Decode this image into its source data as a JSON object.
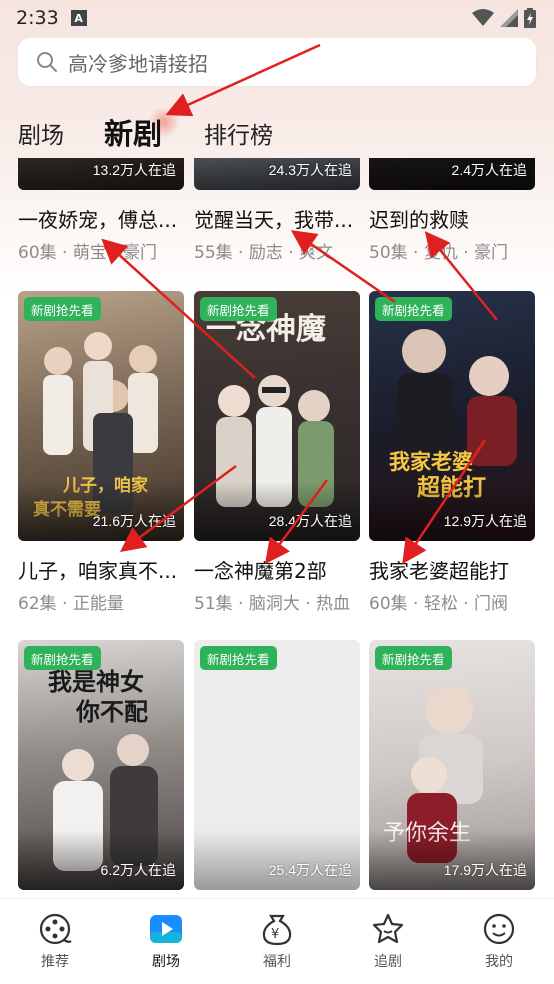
{
  "status_bar": {
    "time": "2:33",
    "notif_letter": "A"
  },
  "search": {
    "placeholder": "高冷爹地请接招"
  },
  "tabs": [
    {
      "label": "剧场",
      "active": false
    },
    {
      "label": "新剧",
      "active": true
    },
    {
      "label": "排行榜",
      "active": false
    }
  ],
  "top_row": [
    {
      "viewers": "13.2万人在追",
      "title": "一夜娇宠，傅总...",
      "meta": "60集 · 萌宝 · 豪门"
    },
    {
      "viewers": "24.3万人在追",
      "title": "觉醒当天，我带...",
      "meta": "55集 · 励志 · 爽文"
    },
    {
      "viewers": "2.4万人在追",
      "title": "迟到的救赎",
      "meta": "50集 · 复仇 · 豪门"
    }
  ],
  "middle_row": [
    {
      "badge": "新剧抢先看",
      "viewers": "21.6万人在追",
      "title": "儿子，咱家真不...",
      "meta": "62集 · 正能量",
      "poster_text": "儿子，咱家真不需要..."
    },
    {
      "badge": "新剧抢先看",
      "viewers": "28.4万人在追",
      "title": "一念神魔第2部",
      "meta": "51集 · 脑洞大 · 热血",
      "poster_text": "一念神魔"
    },
    {
      "badge": "新剧抢先看",
      "viewers": "12.9万人在追",
      "title": "我家老婆超能打",
      "meta": "60集 · 轻松 · 门阀",
      "poster_text": "我家老婆超能打"
    }
  ],
  "bottom_row": [
    {
      "badge": "新剧抢先看",
      "viewers": "6.2万人在追",
      "poster_text": "我是神女你不配"
    },
    {
      "badge": "新剧抢先看",
      "viewers": "25.4万人在追",
      "poster_text": ""
    },
    {
      "badge": "新剧抢先看",
      "viewers": "17.9万人在追",
      "poster_text": "予你余生欢喜"
    }
  ],
  "bottom_nav": [
    {
      "label": "推荐",
      "icon": "film-reel-icon",
      "active": false
    },
    {
      "label": "剧场",
      "icon": "play-icon",
      "active": true
    },
    {
      "label": "福利",
      "icon": "yuan-bag-icon",
      "active": false
    },
    {
      "label": "追剧",
      "icon": "star-icon",
      "active": false
    },
    {
      "label": "我的",
      "icon": "smiley-face-icon",
      "active": false
    }
  ],
  "colors": {
    "accent": "#2fb35a",
    "annotation_arrow": "#e02020",
    "play_blue": "#1a8cff"
  }
}
